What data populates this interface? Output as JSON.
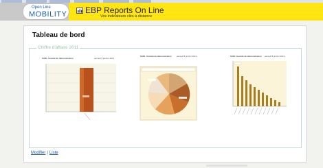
{
  "header": {
    "logo_line1": "Open Line",
    "logo_line2": "MOBILITY",
    "app_title": "EBP Reports On Line",
    "app_subtitle": "Vos indicateurs clés à distance",
    "accent_color": "#ffe512",
    "brand_color": "#1d5fa8"
  },
  "page": {
    "title": "Tableau de bord",
    "section_legend": "Chiffre d'affaire 2011"
  },
  "charts": {
    "company": "SARL Société de démonstration",
    "date": "samedi 8 janvier 2011",
    "icons": [
      "bar-chart-thumbnail",
      "pie-chart-thumbnail",
      "bar-chart-thumbnail"
    ]
  },
  "footer": {
    "modify_label": "Modifier",
    "separator": "|",
    "list_label": "Liste"
  }
}
